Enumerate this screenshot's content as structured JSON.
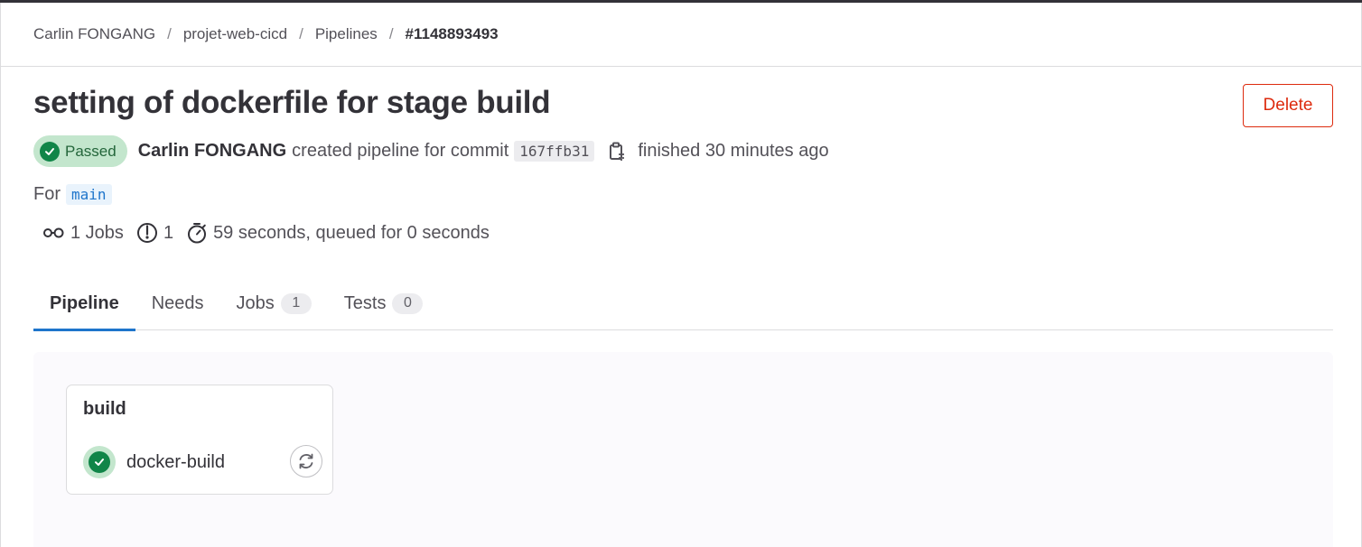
{
  "breadcrumb": {
    "items": [
      "Carlin FONGANG",
      "projet-web-cicd",
      "Pipelines"
    ],
    "separator": "/",
    "current": "#1148893493"
  },
  "header": {
    "title": "setting of dockerfile for stage build",
    "delete_label": "Delete"
  },
  "meta": {
    "status": "Passed",
    "author": "Carlin FONGANG",
    "action_text": "created pipeline for commit",
    "commit_sha": "167ffb31",
    "finished_text": "finished 30 minutes ago",
    "for_label": "For",
    "branch": "main"
  },
  "stats": {
    "jobs": "1 Jobs",
    "stages": "1",
    "duration": "59 seconds, queued for 0 seconds"
  },
  "tabs": [
    {
      "label": "Pipeline",
      "count": null,
      "active": true
    },
    {
      "label": "Needs",
      "count": null,
      "active": false
    },
    {
      "label": "Jobs",
      "count": "1",
      "active": false
    },
    {
      "label": "Tests",
      "count": "0",
      "active": false
    }
  ],
  "pipeline": {
    "stages": [
      {
        "name": "build",
        "jobs": [
          {
            "name": "docker-build",
            "status": "passed"
          }
        ]
      }
    ]
  },
  "colors": {
    "success": "#108548",
    "success_bg": "#c3e6cd",
    "danger": "#dd2b0e",
    "active_tab": "#1f75cb"
  },
  "icons": {
    "status": "check-circle-icon",
    "copy": "copy-to-clipboard-icon",
    "jobs": "pipeline-icon",
    "stages": "stage-icon",
    "duration": "timer-icon",
    "retry": "retry-icon"
  }
}
